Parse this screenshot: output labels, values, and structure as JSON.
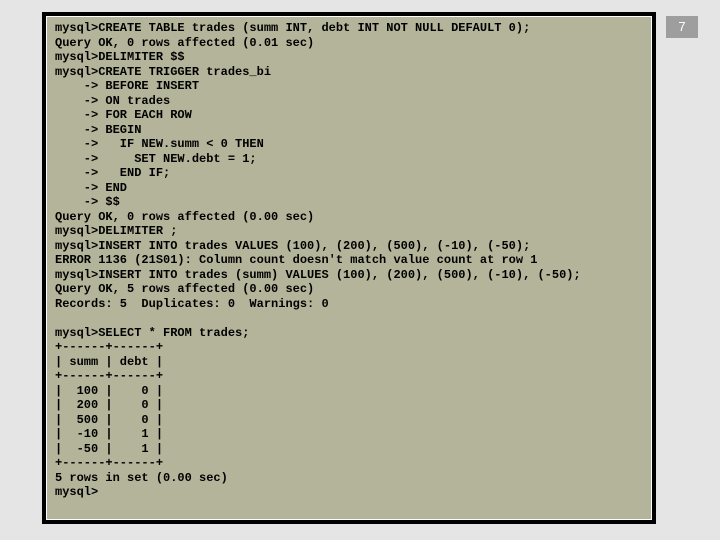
{
  "page_number": "7",
  "terminal_text": "mysql>CREATE TABLE trades (summ INT, debt INT NOT NULL DEFAULT 0);\nQuery OK, 0 rows affected (0.01 sec)\nmysql>DELIMITER $$\nmysql>CREATE TRIGGER trades_bi\n    -> BEFORE INSERT\n    -> ON trades\n    -> FOR EACH ROW\n    -> BEGIN\n    ->   IF NEW.summ < 0 THEN\n    ->     SET NEW.debt = 1;\n    ->   END IF;\n    -> END\n    -> $$\nQuery OK, 0 rows affected (0.00 sec)\nmysql>DELIMITER ;\nmysql>INSERT INTO trades VALUES (100), (200), (500), (-10), (-50);\nERROR 1136 (21S01): Column count doesn't match value count at row 1\nmysql>INSERT INTO trades (summ) VALUES (100), (200), (500), (-10), (-50);\nQuery OK, 5 rows affected (0.00 sec)\nRecords: 5  Duplicates: 0  Warnings: 0\n\nmysql>SELECT * FROM trades;\n+------+------+\n| summ | debt |\n+------+------+\n|  100 |    0 |\n|  200 |    0 |\n|  500 |    0 |\n|  -10 |    1 |\n|  -50 |    1 |\n+------+------+\n5 rows in set (0.00 sec)\nmysql>"
}
